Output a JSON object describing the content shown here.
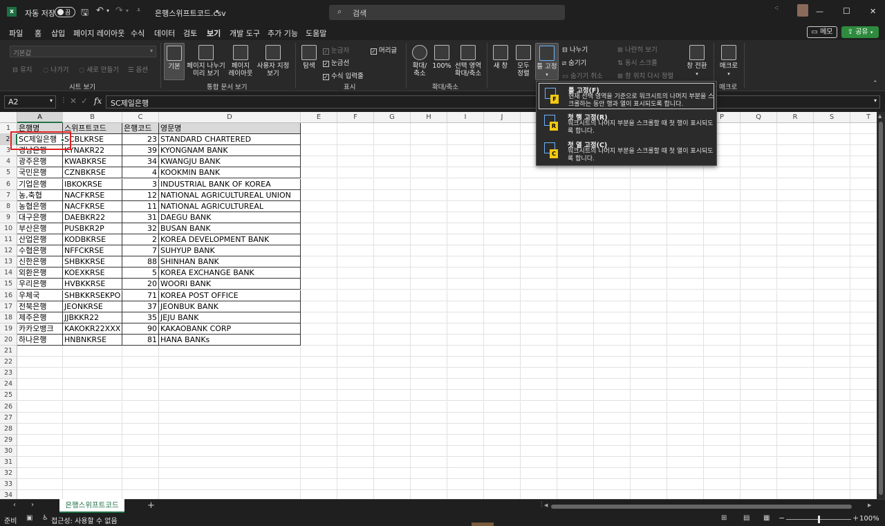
{
  "titlebar": {
    "autosave_label": "자동 저장",
    "autosave_state": "끔",
    "filename": "은행스위프트코드.csv",
    "search_placeholder": "검색",
    "min": "—",
    "max": "☐",
    "close": "✕"
  },
  "menu": {
    "tabs": [
      "파일",
      "홈",
      "삽입",
      "페이지 레이아웃",
      "수식",
      "데이터",
      "검토",
      "보기",
      "개발 도구",
      "추가 기능",
      "도움말"
    ],
    "active": "보기",
    "memo_label": "메모",
    "share_label": "공유"
  },
  "ribbon": {
    "sheet_view": {
      "dropdown_value": "기본값",
      "keep": "유지",
      "exit": "나가기",
      "new": "새로 만들기",
      "options": "옵션",
      "group": "시트 보기"
    },
    "workbook_views": {
      "normal": "기본",
      "page_break_1": "페이지 나누기",
      "page_break_2": "미리 보기",
      "page_layout_1": "페이지",
      "page_layout_2": "레이아웃",
      "custom_1": "사용자 지정",
      "custom_2": "보기",
      "group": "통합 문서 보기"
    },
    "show": {
      "navigation": "탐색",
      "ruler": "눈금자",
      "gridlines": "눈금선",
      "formula_bar": "수식 입력줄",
      "headings": "머리글",
      "group": "표시"
    },
    "zoom": {
      "zoom_1": "확대/",
      "zoom_2": "축소",
      "hundred": "100%",
      "to_sel_1": "선택 영역",
      "to_sel_2": "확대/축소",
      "group": "확대/축소"
    },
    "window": {
      "new_window": "새 창",
      "arrange_1": "모두",
      "arrange_2": "정렬",
      "freeze_1": "틀 고정",
      "split": "나누기",
      "hide": "숨기기",
      "unhide": "숨기기 취소",
      "side_by_side": "나란히 보기",
      "sync_scroll": "동시 스크롤",
      "reset_pos": "창 위치 다시 정렬",
      "switch_1": "창 전환",
      "group": ""
    },
    "macros": {
      "macro": "매크로",
      "group": "매크로"
    }
  },
  "freeze_menu": {
    "items": [
      {
        "title": "틀 고정(F)",
        "desc": "현재 선택 영역을 기준으로 워크시트의 나머지 부분을 스크롤하는 동안 행과 열이 표시되도록 합니다.",
        "badge": "F"
      },
      {
        "title": "첫 행 고정(R)",
        "desc": "워크시트의 나머지 부분을 스크롤할 때 첫 행이 표시되도록 합니다.",
        "badge": "R"
      },
      {
        "title": "첫 열 고정(C)",
        "desc": "워크시트의 나머지 부분을 스크롤할 때 첫 열이 표시되도록 합니다.",
        "badge": "C"
      }
    ]
  },
  "formula_bar": {
    "name_box": "A2",
    "fx": "fx",
    "value": "SC제일은행"
  },
  "grid": {
    "columns": [
      "A",
      "B",
      "C",
      "D",
      "E",
      "F",
      "G",
      "H",
      "I",
      "J",
      "K",
      "L",
      "M",
      "N",
      "O",
      "P",
      "Q",
      "R",
      "S",
      "T"
    ],
    "headers": [
      "은행명",
      "스위프트코드",
      "은행코드",
      "영문명"
    ],
    "rows": [
      [
        "SC제일은행",
        "SCBLKRSE",
        "23",
        "STANDARD CHARTERED"
      ],
      [
        "경남은행",
        "KYNAKR22",
        "39",
        "KYONGNAM BANK"
      ],
      [
        "광주은행",
        "KWABKRSE",
        "34",
        "KWANGJU BANK"
      ],
      [
        "국민은행",
        "CZNBKRSE",
        "4",
        "KOOKMIN BANK"
      ],
      [
        "기업은행",
        "IBKOKRSE",
        "3",
        "INDUSTRIAL BANK OF KOREA"
      ],
      [
        "농,축협",
        "NACFKRSE",
        "12",
        "NATIONAL AGRICULTUREAL UNION"
      ],
      [
        "농협은행",
        "NACFKRSE",
        "11",
        "NATIONAL AGRICULTUREAL"
      ],
      [
        "대구은행",
        "DAEBKR22",
        "31",
        "DAEGU BANK"
      ],
      [
        "부산은행",
        "PUSBKR2P",
        "32",
        "BUSAN BANK"
      ],
      [
        "산업은행",
        "KODBKRSE",
        "2",
        "KOREA DEVELOPMENT BANK"
      ],
      [
        "수협은행",
        "NFFCKRSE",
        "7",
        "SUHYUP BANK"
      ],
      [
        "신한은행",
        "SHBKKRSE",
        "88",
        "SHINHAN BANK"
      ],
      [
        "외환은행",
        "KOEXKRSE",
        "5",
        "KOREA EXCHANGE BANK"
      ],
      [
        "우리은행",
        "HVBKKRSE",
        "20",
        "WOORI BANK"
      ],
      [
        "우체국",
        "SHBKKRSEKPO",
        "71",
        "KOREA POST OFFICE"
      ],
      [
        "전북은행",
        "JEONKRSE",
        "37",
        "JEONBUK BANK"
      ],
      [
        "제주은행",
        "JJBKKR22",
        "35",
        "JEJU BANK"
      ],
      [
        "카카오뱅크",
        "KAKOKR22XXX",
        "90",
        "KAKAOBANK CORP"
      ],
      [
        "하나은행",
        "HNBNKRSE",
        "81",
        "HANA BANKs"
      ]
    ],
    "row_count": 34
  },
  "sheetbar": {
    "tab": "은행스위프트코드",
    "add": "+"
  },
  "statusbar": {
    "ready": "준비",
    "accessibility": "접근성: 사용할 수 없음",
    "zoom": "100%"
  },
  "colors": {
    "accent_green": "#217346",
    "selection_red": "#e02020",
    "share_green": "#2e8b3e"
  }
}
